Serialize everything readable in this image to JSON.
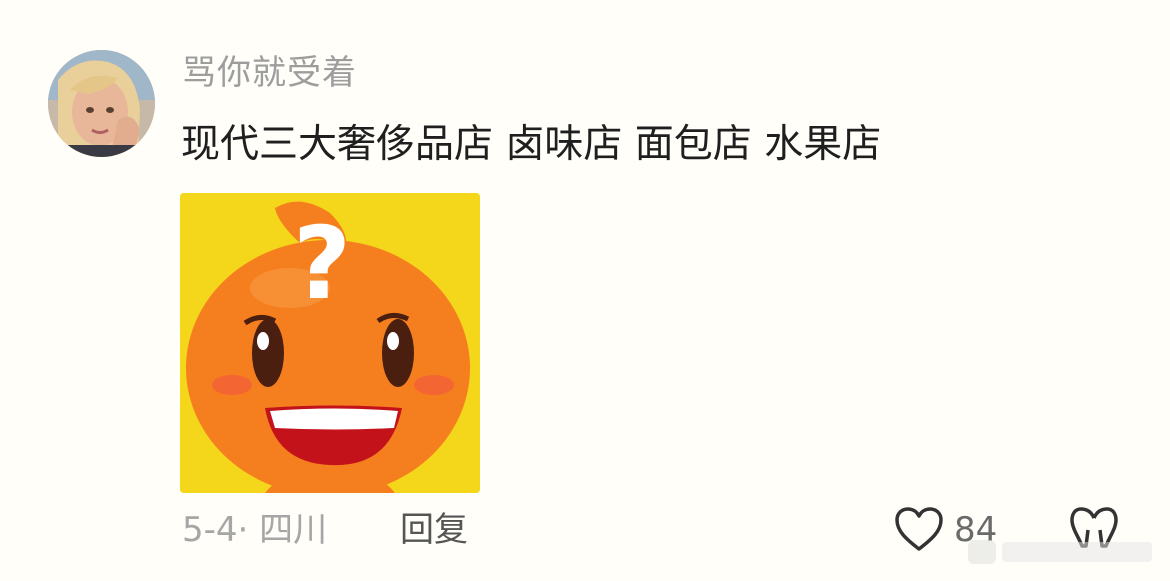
{
  "comment": {
    "username": "骂你就受着",
    "text": "现代三大奢侈品店 卤味店 面包店 水果店",
    "date": "5-4",
    "separator": "·",
    "location": "四川",
    "reply_label": "回复",
    "like_count": "84"
  },
  "sticker": {
    "description_icon": "orange-mascot-question-sticker",
    "question_mark": "?"
  },
  "colors": {
    "background": "#fffef9",
    "username": "#9d9d9d",
    "text": "#1f1f1f",
    "meta": "#a6a6a6",
    "sticker_bg": "#f4d61a",
    "mascot_orange": "#f57f1e"
  }
}
